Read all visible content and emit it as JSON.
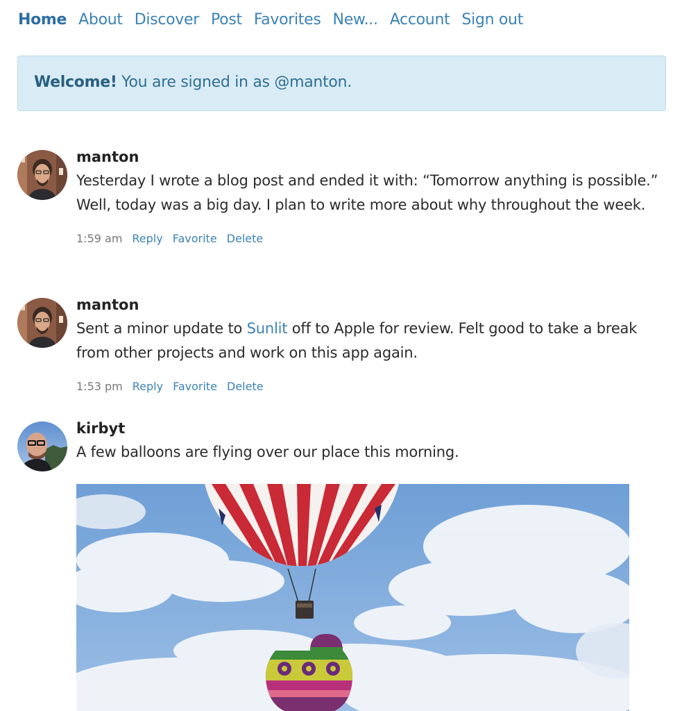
{
  "nav": {
    "items": [
      {
        "label": "Home",
        "active": true
      },
      {
        "label": "About"
      },
      {
        "label": "Discover"
      },
      {
        "label": "Post"
      },
      {
        "label": "Favorites"
      },
      {
        "label": "New..."
      },
      {
        "label": "Account"
      },
      {
        "label": "Sign out"
      }
    ]
  },
  "welcome": {
    "strong": "Welcome!",
    "message": " You are signed in as @manton."
  },
  "posts": [
    {
      "username": "manton",
      "text": "Yesterday I wrote a blog post and ended it with: “Tomorrow anything is possible.” Well, today was a big day. I plan to write more about why throughout the week.",
      "time": "1:59 am",
      "actions": {
        "reply": "Reply",
        "favorite": "Favorite",
        "delete": "Delete"
      }
    },
    {
      "username": "manton",
      "text_before": "Sent a minor update to ",
      "link": "Sunlit",
      "text_after": " off to Apple for review. Felt good to take a break from other projects and work on this app again.",
      "time": "1:53 pm",
      "actions": {
        "reply": "Reply",
        "favorite": "Favorite",
        "delete": "Delete"
      }
    },
    {
      "username": "kirbyt",
      "text": "A few balloons are flying over our place this morning."
    }
  ],
  "colors": {
    "link": "#3b82b6",
    "alert_bg": "#d9ecf6",
    "alert_border": "#b8dbec",
    "alert_text": "#2f6f93"
  },
  "icons": {
    "avatar_manton": "avatar-icon",
    "avatar_kirbyt": "avatar-icon"
  }
}
